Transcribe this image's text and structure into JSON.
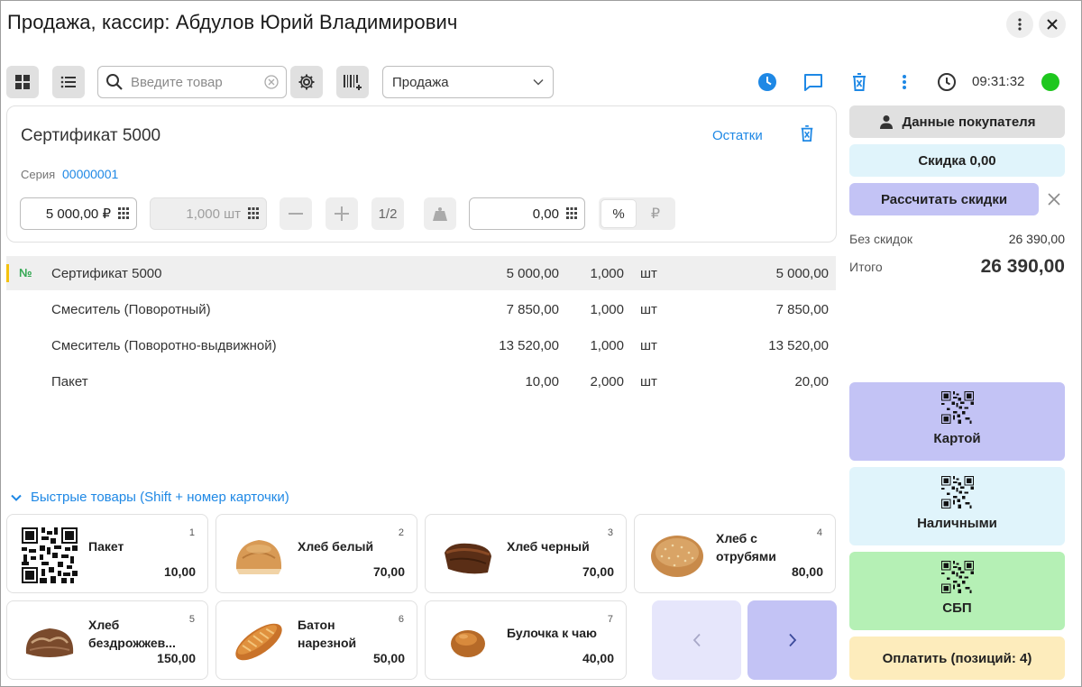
{
  "header": {
    "title": "Продажа, кассир: Абдулов Юрий Владимирович"
  },
  "toolbar": {
    "search_placeholder": "Введите товар",
    "mode_value": "Продажа",
    "time": "09:31:32",
    "status_color": "#1ec71e",
    "accent_color": "#1e88e5"
  },
  "current_item": {
    "name": "Сертификат 5000",
    "stock_link": "Остатки",
    "serie_label": "Серия",
    "serie_value": "00000001",
    "price": "5 000,00 ₽",
    "quantity": "1,000 шт",
    "half_label": "1/2",
    "discount": "0,00",
    "percent_label": "%",
    "ruble_label": "₽"
  },
  "table": {
    "number_header": "№",
    "rows": [
      {
        "name": "Сертификат 5000",
        "price": "5 000,00",
        "qty": "1,000",
        "unit": "шт",
        "total": "5 000,00"
      },
      {
        "name": "Смеситель (Поворотный)",
        "price": "7 850,00",
        "qty": "1,000",
        "unit": "шт",
        "total": "7 850,00"
      },
      {
        "name": "Смеситель (Поворотно-выдвижной)",
        "price": "13 520,00",
        "qty": "1,000",
        "unit": "шт",
        "total": "13 520,00"
      },
      {
        "name": "Пакет",
        "price": "10,00",
        "qty": "2,000",
        "unit": "шт",
        "total": "20,00"
      }
    ]
  },
  "quick": {
    "header": "Быстрые товары (Shift + номер карточки)",
    "items": [
      {
        "index": "1",
        "name": "Пакет",
        "price": "10,00",
        "icon": "qr-code-icon"
      },
      {
        "index": "2",
        "name": "Хлеб белый",
        "price": "70,00",
        "icon": "white-bread-image"
      },
      {
        "index": "3",
        "name": "Хлеб черный",
        "price": "70,00",
        "icon": "black-bread-image"
      },
      {
        "index": "4",
        "name": "Хлеб с отрубями",
        "price": "80,00",
        "icon": "bran-bread-image"
      },
      {
        "index": "5",
        "name": "Хлеб бездрожжев...",
        "price": "150,00",
        "icon": "yeast-free-bread-image"
      },
      {
        "index": "6",
        "name": "Батон нарезной",
        "price": "50,00",
        "icon": "loaf-image"
      },
      {
        "index": "7",
        "name": "Булочка к чаю",
        "price": "40,00",
        "icon": "bun-image"
      }
    ]
  },
  "side": {
    "customer_btn": "Данные покупателя",
    "discount_btn": "Скидка 0,00",
    "calc_btn": "Рассчитать скидки",
    "no_discount_label": "Без скидок",
    "no_discount_value": "26 390,00",
    "total_label": "Итого",
    "total_value": "26 390,00",
    "pay_card": "Картой",
    "pay_cash": "Наличными",
    "pay_sbp": "СБП",
    "pay_all": "Оплатить (позиций: 4)"
  }
}
